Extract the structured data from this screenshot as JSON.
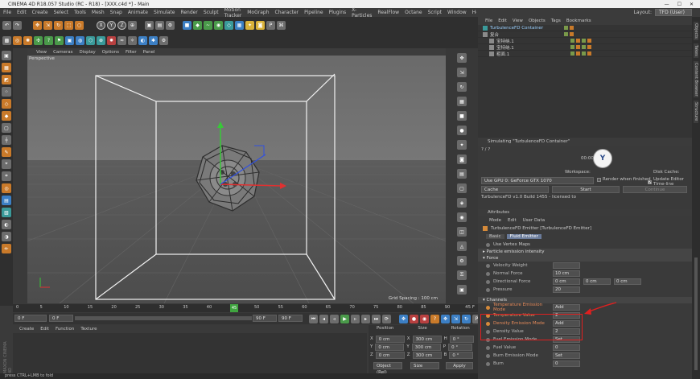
{
  "window": {
    "title": "CINEMA 4D R18.057 Studio (RC - R18) - [XXX.c4d *] - Main"
  },
  "menu": [
    "File",
    "Edit",
    "Create",
    "Select",
    "Tools",
    "Mesh",
    "Snap",
    "Animate",
    "Simulate",
    "Render",
    "Sculpt",
    "Motion Tracker",
    "MoGraph",
    "Character",
    "Pipeline",
    "Plugins",
    "X-Particles",
    "RealFlow",
    "Octane",
    "Script",
    "Window",
    "Help"
  ],
  "layout": {
    "label": "Layout:",
    "value": "TFD (User)"
  },
  "viewport": {
    "menu": [
      "View",
      "Cameras",
      "Display",
      "Options",
      "Filter",
      "Panel"
    ],
    "camera": "Perspective",
    "grid_spacing": "Grid Spacing : 100 cm"
  },
  "timeline": {
    "ticks": [
      "0",
      "5",
      "10",
      "15",
      "20",
      "25",
      "30",
      "35",
      "40",
      "45",
      "50",
      "55",
      "60",
      "65",
      "70",
      "75",
      "80",
      "85",
      "90"
    ],
    "current_frame": "45",
    "end_label": "45 F"
  },
  "transport": {
    "start": "0 F",
    "left": "0 F",
    "right": "90 F",
    "end": "90 F"
  },
  "material_menu": [
    "Create",
    "Edit",
    "Function",
    "Texture"
  ],
  "coords": {
    "headers": [
      "Position",
      "Size",
      "Rotation"
    ],
    "rows": [
      {
        "axis": "X",
        "pos": "0 cm",
        "size": "300 cm",
        "rot_axis": "H",
        "rot": "0 °"
      },
      {
        "axis": "Y",
        "pos": "0 cm",
        "size": "300 cm",
        "rot_axis": "P",
        "rot": "0 °"
      },
      {
        "axis": "Z",
        "pos": "0 cm",
        "size": "300 cm",
        "rot_axis": "B",
        "rot": "0 °"
      }
    ],
    "mode1": "Object (Rel)",
    "mode2": "Size",
    "apply": "Apply"
  },
  "status": "press CTRL+LMB to fold",
  "object_manager": {
    "menu": [
      "File",
      "Edit",
      "View",
      "Objects",
      "Tags",
      "Bookmarks"
    ],
    "objects": [
      {
        "name": "TurbulenceFD Container",
        "indent": 0
      },
      {
        "name": "复合",
        "indent": 0
      },
      {
        "name": "宝特纳.1",
        "indent": 1
      },
      {
        "name": "宝特纳.1",
        "indent": 1
      },
      {
        "name": "粗面.1",
        "indent": 1
      }
    ]
  },
  "side_tabs": [
    "Objects",
    "Takes",
    "Content Browser",
    "Structure"
  ],
  "simulation": {
    "title": "Simulating \"TurbulenceFD Container\"",
    "frames": "? / ?",
    "time": "00:00",
    "workspace": "Workspace:",
    "disk_cache": "Disk Cache:",
    "gpu": "Use GPU 0: GeForce GTX 1070",
    "render_when_finished": "Render when finished",
    "update_editor": "Update Editor Time-line",
    "cache": "Cache",
    "start": "Start",
    "continue": "Continue",
    "version": "TurbulenceFD v1.0 Build 1455 - licensed to"
  },
  "attributes": {
    "title": "Attributes",
    "menu": [
      "Mode",
      "Edit",
      "User Data"
    ],
    "object": "TurbulenceFD Emitter [TurbulenceFD Emitter]",
    "tabs": [
      "Basic",
      "Fluid Emitter"
    ],
    "use_vertex_maps": "Use Vertex Maps",
    "sections": {
      "particle": "Particle emission intensity",
      "force": "Force",
      "channels": "Channels"
    },
    "force": [
      {
        "label": "Velocity Weight",
        "value": ""
      },
      {
        "label": "Normal Force",
        "value": "10 cm"
      },
      {
        "label": "Directional Force",
        "value": "0 cm",
        "v2": "0 cm",
        "v3": "0 cm"
      },
      {
        "label": "Pressure",
        "value": "20"
      }
    ],
    "channels": [
      {
        "label": "Temperature Emission Mode",
        "value": "Add",
        "hl": true
      },
      {
        "label": "Temperature Value",
        "value": "2",
        "hl": true
      },
      {
        "label": "Density Emission Mode",
        "value": "Add",
        "hl": true
      },
      {
        "label": "Density Value",
        "value": "2",
        "hl": false
      },
      {
        "label": "Fuel Emission Mode",
        "value": "Set",
        "hl": false
      },
      {
        "label": "Fuel Value",
        "value": "0",
        "hl": false
      },
      {
        "label": "Burn Emission Mode",
        "value": "Set",
        "hl": false
      },
      {
        "label": "Burn",
        "value": "0",
        "hl": false
      }
    ]
  }
}
